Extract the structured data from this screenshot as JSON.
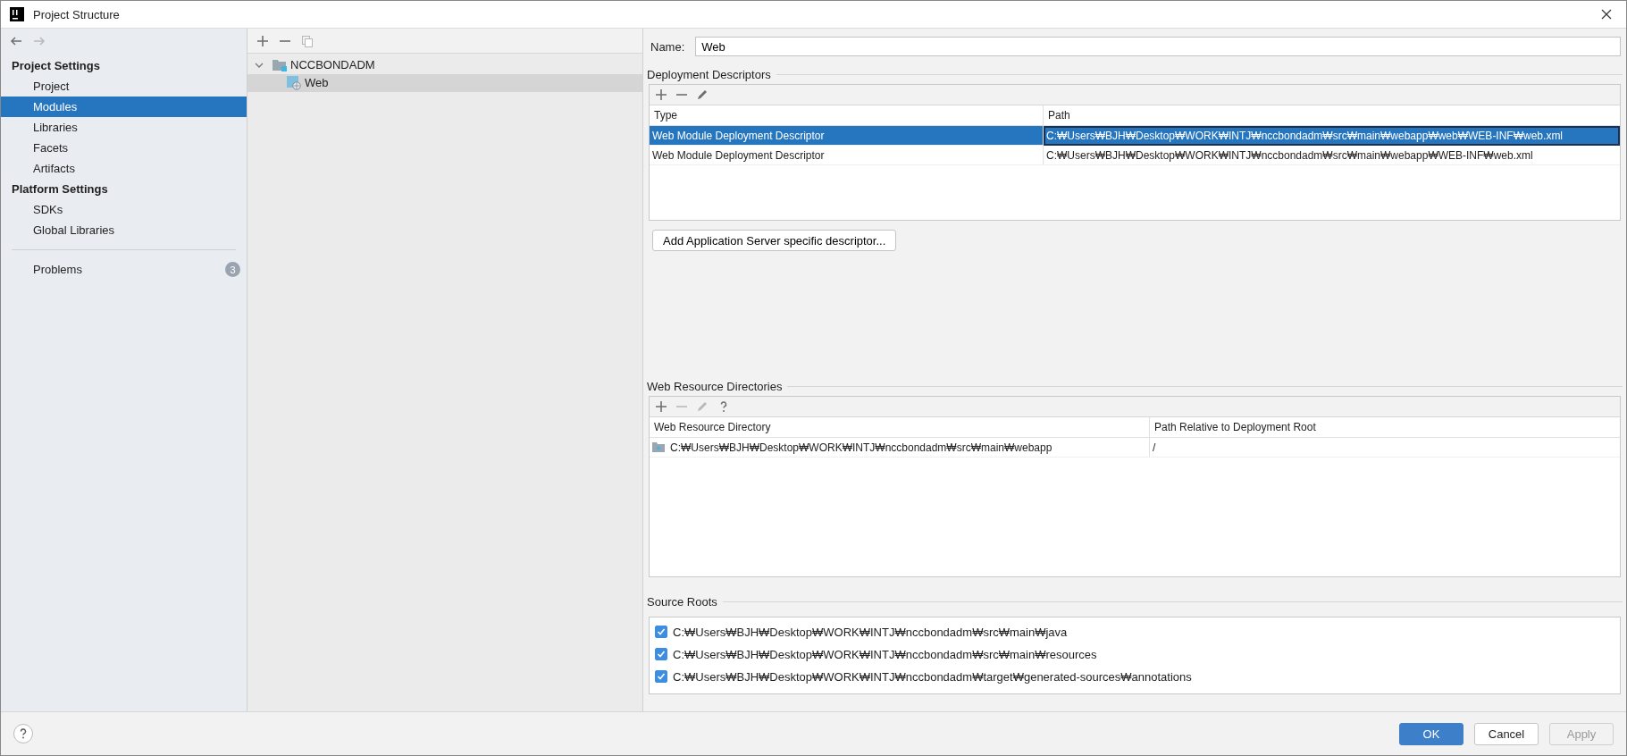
{
  "window": {
    "title": "Project Structure"
  },
  "nav_buttons": [
    {
      "kind": "back",
      "disabled": false
    },
    {
      "kind": "forward",
      "disabled": true
    }
  ],
  "sidebar": {
    "sections": [
      {
        "heading": "Project Settings",
        "items": [
          {
            "label": "Project",
            "selected": false
          },
          {
            "label": "Modules",
            "selected": true
          },
          {
            "label": "Libraries",
            "selected": false
          },
          {
            "label": "Facets",
            "selected": false
          },
          {
            "label": "Artifacts",
            "selected": false
          }
        ]
      },
      {
        "heading": "Platform Settings",
        "items": [
          {
            "label": "SDKs",
            "selected": false
          },
          {
            "label": "Global Libraries",
            "selected": false
          }
        ]
      }
    ],
    "problems": {
      "label": "Problems",
      "count": "3"
    }
  },
  "tree": {
    "toolbar": [
      {
        "kind": "add",
        "disabled": false
      },
      {
        "kind": "remove",
        "disabled": false
      },
      {
        "kind": "copy",
        "disabled": true
      }
    ],
    "nodes": [
      {
        "label": "NCCBONDADM",
        "kind": "project",
        "expanded": true,
        "selected": false,
        "children": [
          {
            "label": "Web",
            "kind": "web",
            "selected": true
          }
        ]
      }
    ]
  },
  "module": {
    "name_label": "Name:",
    "name_value": "Web",
    "deployment_descriptors": {
      "title": "Deployment Descriptors",
      "toolbar": [
        {
          "kind": "add",
          "disabled": false
        },
        {
          "kind": "remove",
          "disabled": false
        },
        {
          "kind": "edit",
          "disabled": false
        }
      ],
      "columns": [
        "Type",
        "Path"
      ],
      "rows": [
        {
          "cells": [
            "Web Module Deployment Descriptor",
            "C:₩Users₩BJH₩Desktop₩WORK₩INTJ₩nccbondadm₩src₩main₩webapp₩web₩WEB-INF₩web.xml"
          ],
          "selected": true
        },
        {
          "cells": [
            "Web Module Deployment Descriptor",
            "C:₩Users₩BJH₩Desktop₩WORK₩INTJ₩nccbondadm₩src₩main₩webapp₩WEB-INF₩web.xml"
          ],
          "selected": false
        }
      ]
    },
    "add_button": "Add Application Server specific descriptor...",
    "web_resource_directories": {
      "title": "Web Resource Directories",
      "toolbar": [
        {
          "kind": "add",
          "disabled": false
        },
        {
          "kind": "remove",
          "disabled": true
        },
        {
          "kind": "edit",
          "disabled": true
        },
        {
          "kind": "help",
          "disabled": false
        }
      ],
      "columns": [
        "Web Resource Directory",
        "Path Relative to Deployment Root"
      ],
      "rows": [
        {
          "cells": [
            "C:₩Users₩BJH₩Desktop₩WORK₩INTJ₩nccbondadm₩src₩main₩webapp",
            "/"
          ],
          "selected": false
        }
      ]
    },
    "source_roots": {
      "title": "Source Roots",
      "items": [
        {
          "path": "C:₩Users₩BJH₩Desktop₩WORK₩INTJ₩nccbondadm₩src₩main₩java",
          "checked": true
        },
        {
          "path": "C:₩Users₩BJH₩Desktop₩WORK₩INTJ₩nccbondadm₩src₩main₩resources",
          "checked": true
        },
        {
          "path": "C:₩Users₩BJH₩Desktop₩WORK₩INTJ₩nccbondadm₩target₩generated-sources₩annotations",
          "checked": true
        }
      ]
    }
  },
  "footer": {
    "buttons": [
      {
        "label": "OK",
        "kind": "primary",
        "disabled": false
      },
      {
        "label": "Cancel",
        "kind": "normal",
        "disabled": false
      },
      {
        "label": "Apply",
        "kind": "normal",
        "disabled": true
      }
    ]
  }
}
